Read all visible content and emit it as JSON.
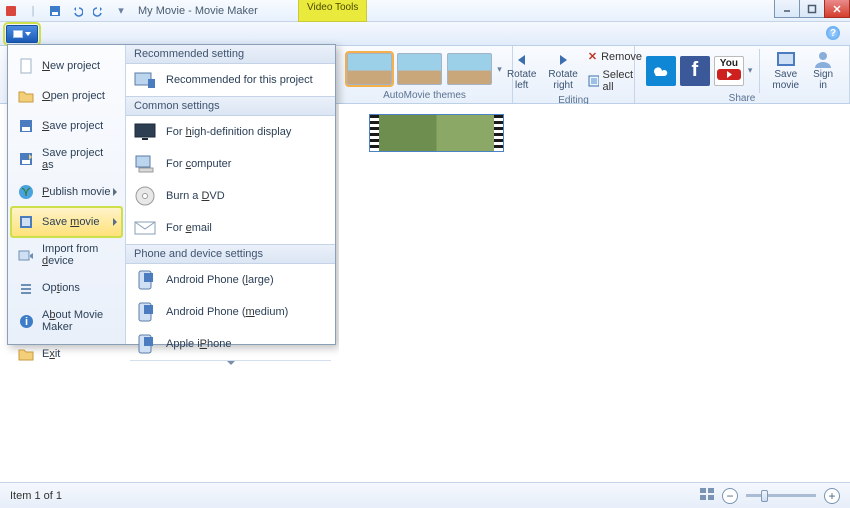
{
  "title": "My Movie - Movie Maker",
  "contextual_tab": "Video Tools",
  "ribbon": {
    "automovie_label": "AutoMovie themes",
    "editing_label": "Editing",
    "share_label": "Share",
    "rotate_left": "Rotate\nleft",
    "rotate_right": "Rotate\nright",
    "remove": "Remove",
    "select_all": "Select all",
    "save_movie": "Save\nmovie",
    "sign_in": "Sign\nin",
    "youtube": "You"
  },
  "app_menu": {
    "items": [
      {
        "label": "New project"
      },
      {
        "label": "Open project"
      },
      {
        "label": "Save project"
      },
      {
        "label": "Save project as"
      },
      {
        "label": "Publish movie",
        "submenu": true
      },
      {
        "label": "Save movie",
        "submenu": true,
        "highlighted": true
      },
      {
        "label": "Import from device"
      },
      {
        "label": "Options"
      },
      {
        "label": "About Movie Maker"
      },
      {
        "label": "Exit"
      }
    ],
    "sections": [
      {
        "header": "Recommended setting",
        "items": [
          {
            "label": "Recommended for this project"
          }
        ]
      },
      {
        "header": "Common settings",
        "items": [
          {
            "label": "For high-definition display"
          },
          {
            "label": "For computer"
          },
          {
            "label": "Burn a DVD"
          },
          {
            "label": "For email"
          }
        ]
      },
      {
        "header": "Phone and device settings",
        "items": [
          {
            "label": "Android Phone (large)"
          },
          {
            "label": "Android Phone (medium)"
          },
          {
            "label": "Apple iPhone"
          }
        ]
      }
    ]
  },
  "status_text": "Item 1 of 1"
}
